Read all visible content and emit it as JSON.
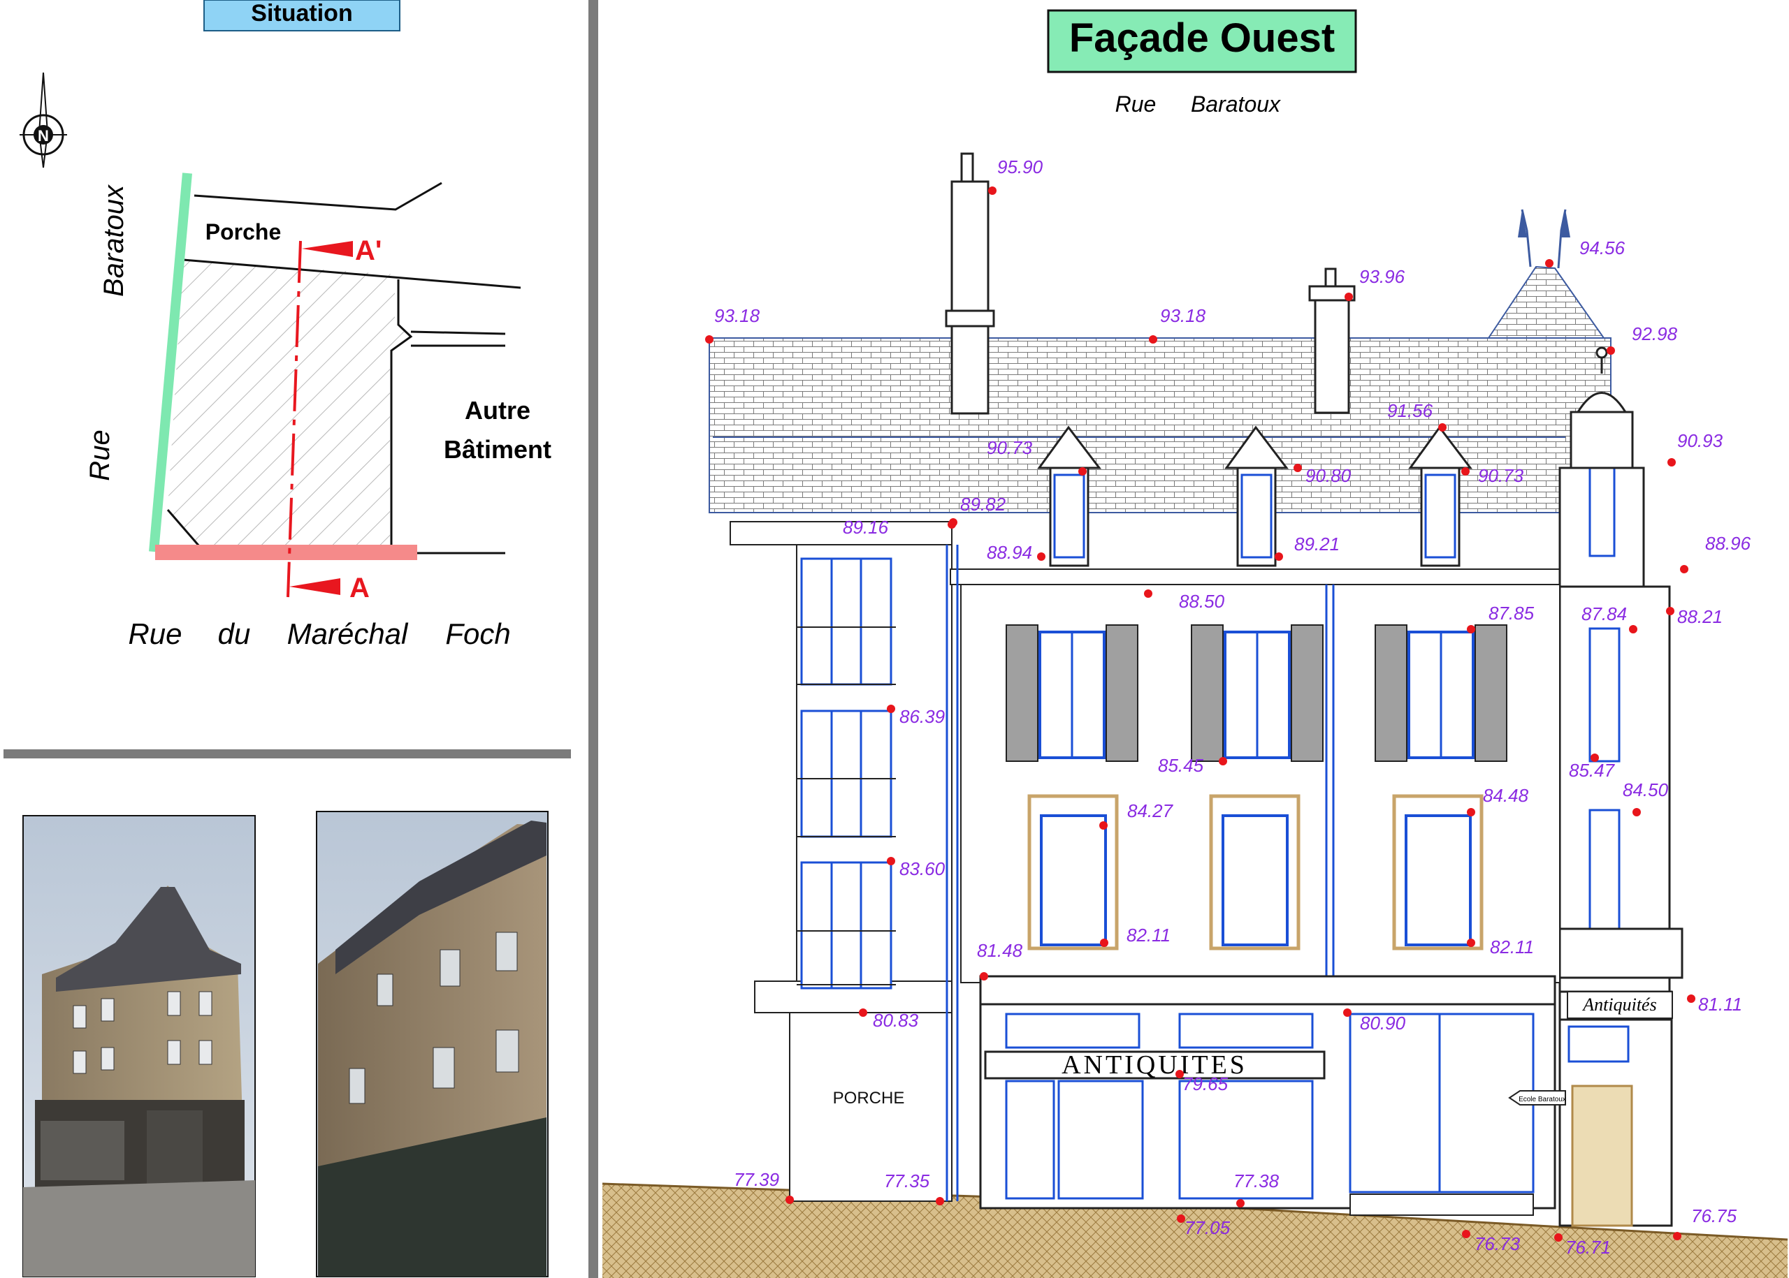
{
  "situation": {
    "title": "Situation",
    "north_label": "N",
    "street_left": [
      "Rue",
      "Baratoux"
    ],
    "street_bottom": [
      "Rue",
      "du",
      "Maréchal",
      "Foch"
    ],
    "porche": "Porche",
    "autre_batiment": [
      "Autre",
      "Bâtiment"
    ],
    "section_top": "A'",
    "section_bottom": "A",
    "colors": {
      "street_green": "#7ee8b0",
      "street_red": "#f58a8a",
      "section_red": "#e8171f",
      "hatch": "#b5b5b5"
    }
  },
  "facade": {
    "title": "Façade Ouest",
    "subtitle": [
      "Rue",
      "Baratoux"
    ],
    "shop_sign": "ANTIQUITES",
    "corner_sign": "Antiquités",
    "street_sign": "Ecole Baratoux",
    "porch_label": "PORCHE",
    "elevations": [
      "95.90",
      "94.56",
      "93.96",
      "93.18",
      "93.18",
      "92.98",
      "91.56",
      "90.93",
      "90.73",
      "90.80",
      "90.73",
      "89.82",
      "89.16",
      "89.21",
      "88.94",
      "88.96",
      "88.50",
      "88.21",
      "87.85",
      "87.84",
      "86.39",
      "85.45",
      "85.47",
      "84.27",
      "84.48",
      "84.50",
      "83.60",
      "82.11",
      "82.11",
      "81.48",
      "81.11",
      "80.83",
      "80.90",
      "79.65",
      "77.39",
      "77.35",
      "77.38",
      "77.05",
      "76.73",
      "76.71",
      "76.75"
    ],
    "colors": {
      "title_bg": "#86ebb5",
      "elevation_text": "#8a2be2",
      "elevation_dot": "#e8151b",
      "window_blue": "#1a4fd6",
      "stone": "#c8a46a",
      "ground": "#c9a770"
    }
  },
  "photos": [
    {
      "name": "photo-corner-view"
    },
    {
      "name": "photo-west-facade-view"
    }
  ]
}
